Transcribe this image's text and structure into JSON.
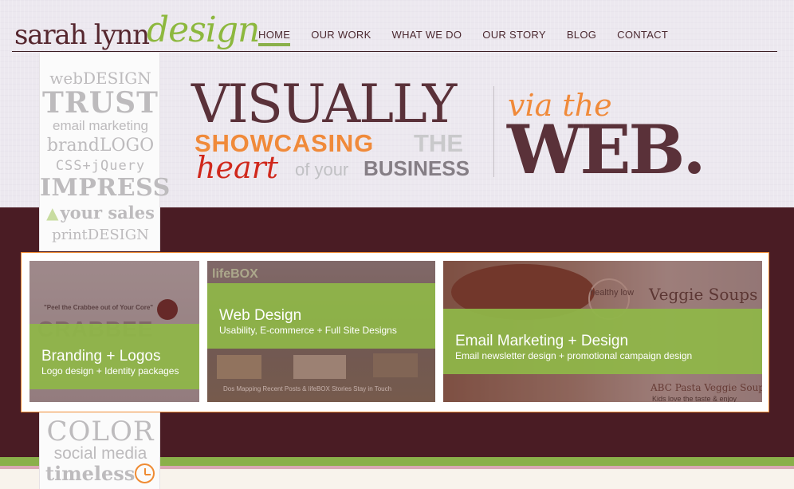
{
  "brand": {
    "logo_main": "sarah lynn",
    "logo_script": "design"
  },
  "nav": {
    "items": [
      {
        "label": "HOME",
        "active": true
      },
      {
        "label": "OUR WORK",
        "active": false
      },
      {
        "label": "WHAT WE DO",
        "active": false
      },
      {
        "label": "OUR STORY",
        "active": false
      },
      {
        "label": "BLOG",
        "active": false
      },
      {
        "label": "CONTACT",
        "active": false
      }
    ]
  },
  "tag_cloud": {
    "top": [
      "webDESIGN",
      "TRUST",
      "email marketing",
      "brandLOGO",
      "CSS+jQuery",
      "IMPRESS",
      "your sales",
      "printDESIGN"
    ],
    "bottom": [
      "COLOR",
      "social media",
      "timeless"
    ],
    "up_arrow_icon": "up-arrow-icon",
    "clock_icon": "clock-icon"
  },
  "hero": {
    "visually": "VISUALLY",
    "showcasing": "SHOWCASING",
    "the": "THE",
    "heart": "heart",
    "of_your": "of your",
    "business": "BUSINESS",
    "via_the": "via the",
    "web": "WEB."
  },
  "services": [
    {
      "title": "Branding + Logos",
      "subtitle": "Logo design + Identity packages",
      "preview": {
        "quote": "\"Peel the Crabbee out of Your Core\"",
        "brand": "CRABBEE"
      }
    },
    {
      "title": "Web Design",
      "subtitle": "Usability, E-commerce + Full Site Designs",
      "preview": {
        "logo": "lifeBOX",
        "footer": "Dos Mapping     Recent Posts & lifeBOX Stories     Stay in Touch"
      }
    },
    {
      "title": "Email Marketing + Design",
      "subtitle": "Email newsletter design + promotional campaign design",
      "preview": {
        "badge": "healthy low",
        "heading": "Veggie Soups",
        "product": "ABC Pasta Veggie Soup",
        "product_tagline": "Kids love the taste & enjoy"
      }
    }
  ],
  "colors": {
    "maroon": "#4a1c24",
    "green": "#8ab04a",
    "orange": "#ef8b33",
    "plum": "#5a3139",
    "red": "#d0281c"
  }
}
